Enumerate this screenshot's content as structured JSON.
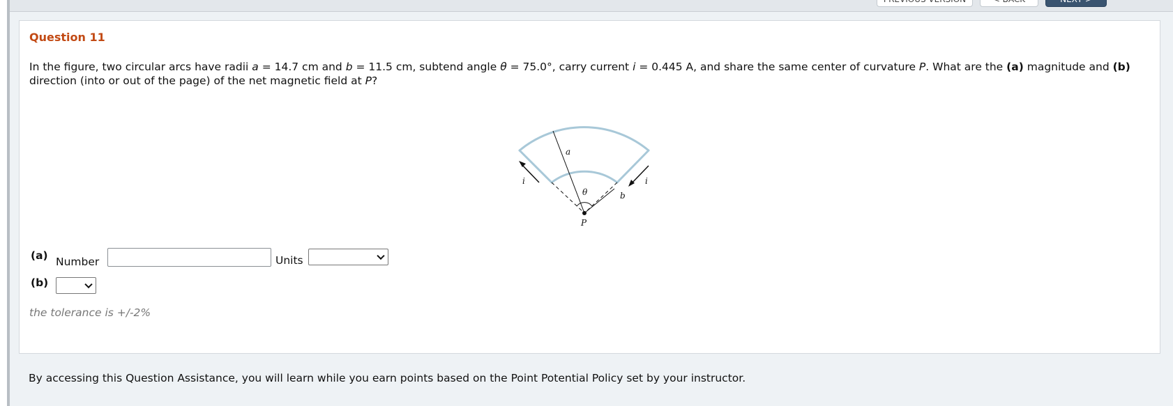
{
  "topbar": {
    "buttons": [
      {
        "label": "PREVIOUS VERSION",
        "style": "light"
      },
      {
        "label": "< BACK",
        "style": "light"
      },
      {
        "label": "NEXT >",
        "style": "dark"
      }
    ]
  },
  "question": {
    "title": "Question 11",
    "text_parts": {
      "p1": "In the figure, two circular arcs have radii ",
      "a_var": "a",
      "p2": " = 14.7 cm and ",
      "b_var": "b",
      "p3": " = 11.5 cm, subtend angle ",
      "theta_var": "θ",
      "p4": " = 75.0°, carry current ",
      "i_var": "i",
      "p5": " = 0.445 A, and share the same center of curvature ",
      "P_var": "P",
      "p6": ". What are the ",
      "a_part": "(a)",
      "p7": " magnitude and ",
      "b_part": "(b)",
      "p8": " direction (into or out of the page) of the net magnetic field at ",
      "P_var2": "P",
      "p9": "?"
    },
    "figure_labels": {
      "a": "a",
      "b": "b",
      "theta": "θ",
      "i_left": "i",
      "i_right": "i",
      "P": "P"
    },
    "part_a": {
      "label": "(a)",
      "number_label": "Number",
      "number_value": "",
      "units_label": "Units",
      "units_selected": ""
    },
    "part_b": {
      "label": "(b)",
      "selected": ""
    },
    "tolerance": "the tolerance is +/-2%"
  },
  "footer": {
    "text": "By accessing this Question Assistance, you will learn while you earn points based on the Point Potential Policy set by your instructor."
  },
  "colors": {
    "title": "#c24a14",
    "arc": "#a8c8d8",
    "next_button": "#3a5470"
  }
}
